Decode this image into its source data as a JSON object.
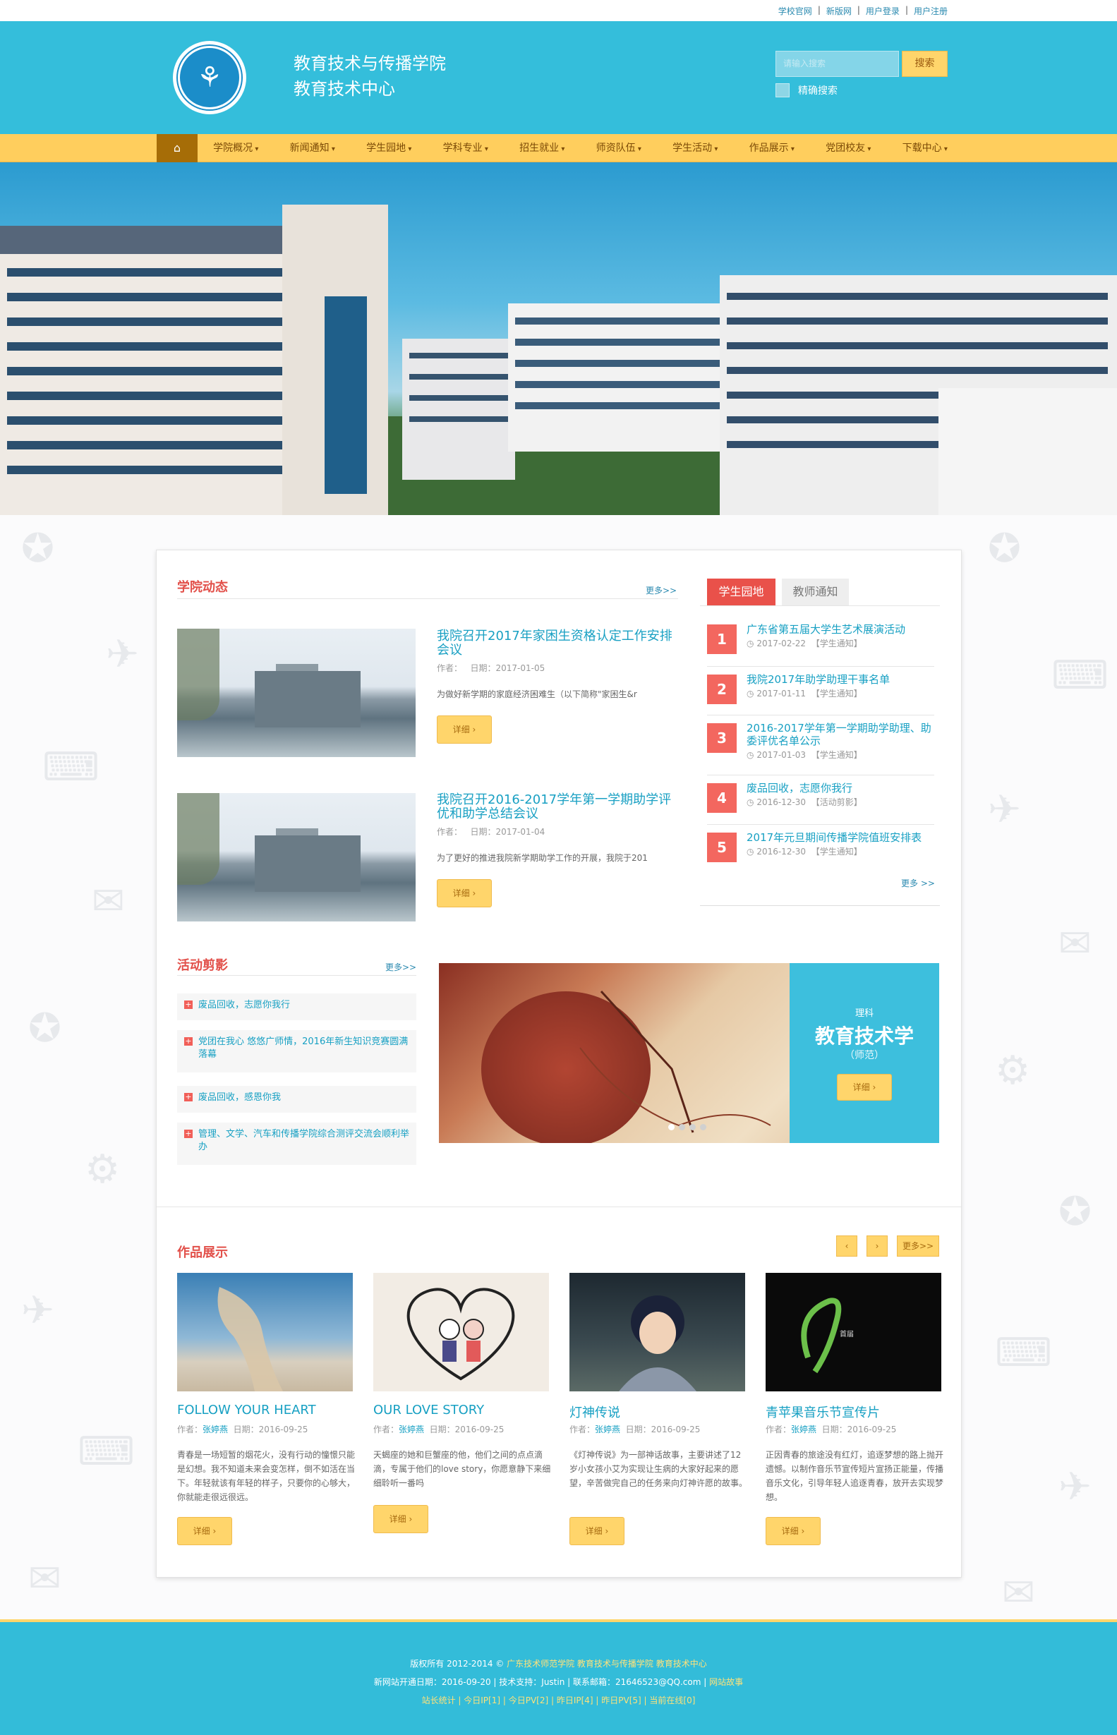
{
  "topbar": {
    "links": [
      "学校官网",
      "新版网",
      "用户登录",
      "用户注册"
    ]
  },
  "header": {
    "title_line1": "教育技术与传播学院",
    "title_line2": "教育技术中心",
    "search_placeholder": "请输入搜索",
    "search_button": "搜索",
    "exact_search_label": "精确搜索"
  },
  "nav": {
    "home_icon": "home-icon",
    "items": [
      "学院概况",
      "新闻通知",
      "学生园地",
      "学科专业",
      "招生就业",
      "师资队伍",
      "学生活动",
      "作品展示",
      "党团校友",
      "下载中心"
    ]
  },
  "news": {
    "title": "学院动态",
    "more": "更多>>",
    "items": [
      {
        "title": "我院召开2017年家困生资格认定工作安排会议",
        "author_label": "作者：",
        "date": "日期：2017-01-05",
        "summary": "为做好新学期的家庭经济困难生（以下简称\"家困生&r",
        "button": "详细"
      },
      {
        "title": "我院召开2016-2017学年第一学期助学评优和助学总结会议",
        "author_label": "作者：",
        "date": "日期：2017-01-04",
        "summary": "为了更好的推进我院新学期助学工作的开展，我院于201",
        "button": "详细"
      }
    ]
  },
  "tabs": {
    "active": "学生园地",
    "inactive": "教师通知",
    "more": "更多 >>",
    "items": [
      {
        "num": "1",
        "title": "广东省第五届大学生艺术展演活动",
        "date": "2017-02-22",
        "cat": "【学生通知】"
      },
      {
        "num": "2",
        "title": "我院2017年助学助理干事名单",
        "date": "2017-01-11",
        "cat": "【学生通知】"
      },
      {
        "num": "3",
        "title": "2016-2017学年第一学期助学助理、助委评优名单公示",
        "date": "2017-01-03",
        "cat": "【学生通知】"
      },
      {
        "num": "4",
        "title": "废品回收，志愿你我行",
        "date": "2016-12-30",
        "cat": "【活动剪影】"
      },
      {
        "num": "5",
        "title": "2017年元旦期间传播学院值班安排表",
        "date": "2016-12-30",
        "cat": "【学生通知】"
      }
    ]
  },
  "activities": {
    "title": "活动剪影",
    "more": "更多>>",
    "items": [
      "废品回收，志愿你我行",
      "党团在我心 悠悠广师情，2016年新生知识竞赛圆满落幕",
      "废品回收，感恩你我",
      "管理、文学、汽车和传播学院综合测评交流会顺利举办"
    ]
  },
  "slide": {
    "small": "理科",
    "big": "教育技术学",
    "sub": "（师范）",
    "button": "详细"
  },
  "works": {
    "title": "作品展示",
    "prev": "‹",
    "next": "›",
    "more": "更多>>",
    "items": [
      {
        "title": "FOLLOW YOUR HEART",
        "author_label": "作者：",
        "author": "张婷燕",
        "date": "日期：2016-09-25",
        "desc": "青春是一场短暂的烟花火，没有行动的憧憬只能是幻想。我不知道未来会变怎样，倒不如活在当下。年轻就该有年轻的样子，只要你的心够大，你就能走很远很远。",
        "button": "详细"
      },
      {
        "title": "OUR LOVE STORY",
        "author_label": "作者：",
        "author": "张婷燕",
        "date": "日期：2016-09-25",
        "desc": "天蝎座的她和巨蟹座的他，他们之间的点点滴滴，专属于他们的love story，你愿意静下来细细聆听一番吗",
        "button": "详细"
      },
      {
        "title": "灯神传说",
        "author_label": "作者：",
        "author": "张婷燕",
        "date": "日期：2016-09-25",
        "desc": "《灯神传说》为一部神话故事，主要讲述了12岁小女孩小艾为实现让生病的大家好起来的愿望，辛苦做完自己的任务来向灯神许愿的故事。",
        "button": "详细"
      },
      {
        "title": "青苹果音乐节宣传片",
        "author_label": "作者：",
        "author": "张婷燕",
        "date": "日期：2016-09-25",
        "desc": "正因青春的旅途没有红灯，追逐梦想的路上抛开遗憾。以制作音乐节宣传短片宣扬正能量，传播音乐文化，引导年轻人追逐青春，放开去实现梦想。",
        "button": "详细"
      }
    ]
  },
  "footer": {
    "line1_prefix": "版权所有 2012-2014 © ",
    "line1_link": "广东技术师范学院 教育技术与传播学院 教育技术中心",
    "line2_prefix": "新网站开通日期：2016-09-20 | 技术支持：Justin | 联系邮箱：21646523@QQ.com | ",
    "line2_link": "网站故事",
    "line3": "站长统计 | 今日IP[1] | 今日PV[2] | 昨日IP[4] | 昨日PV[5] | 当前在线[0]"
  },
  "colors": {
    "header": "#34bedb",
    "nav": "#ffce5d",
    "accent_red": "#e9514a",
    "link_blue": "#17a0c3"
  }
}
